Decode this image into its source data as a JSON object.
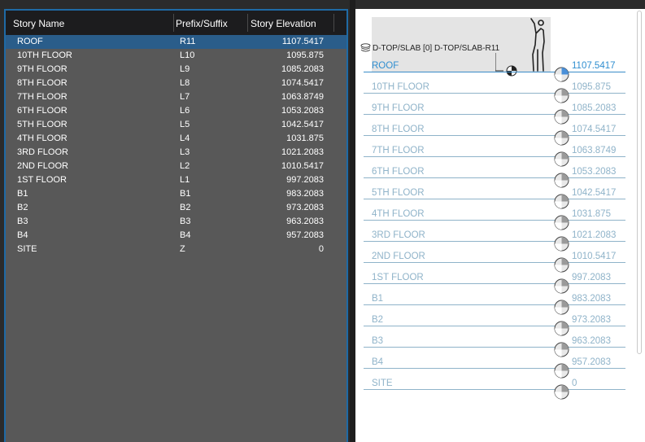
{
  "table": {
    "headers": {
      "name": "Story Name",
      "prefix": "Prefix/Suffix",
      "elevation": "Story Elevation"
    },
    "selected_index": 0,
    "rows": [
      {
        "name": "ROOF",
        "prefix": "R11",
        "elevation": "1107.5417"
      },
      {
        "name": "10TH FLOOR",
        "prefix": "L10",
        "elevation": "1095.875"
      },
      {
        "name": "9TH FLOOR",
        "prefix": "L9",
        "elevation": "1085.2083"
      },
      {
        "name": "8TH FLOOR",
        "prefix": "L8",
        "elevation": "1074.5417"
      },
      {
        "name": "7TH FLOOR",
        "prefix": "L7",
        "elevation": "1063.8749"
      },
      {
        "name": "6TH FLOOR",
        "prefix": "L6",
        "elevation": "1053.2083"
      },
      {
        "name": "5TH FLOOR",
        "prefix": "L5",
        "elevation": "1042.5417"
      },
      {
        "name": "4TH FLOOR",
        "prefix": "L4",
        "elevation": "1031.875"
      },
      {
        "name": "3RD FLOOR",
        "prefix": "L3",
        "elevation": "1021.2083"
      },
      {
        "name": "2ND FLOOR",
        "prefix": "L2",
        "elevation": "1010.5417"
      },
      {
        "name": "1ST FLOOR",
        "prefix": "L1",
        "elevation": "997.2083"
      },
      {
        "name": "B1",
        "prefix": "B1",
        "elevation": "983.2083"
      },
      {
        "name": "B2",
        "prefix": "B2",
        "elevation": "973.2083"
      },
      {
        "name": "B3",
        "prefix": "B3",
        "elevation": "963.2083"
      },
      {
        "name": "B4",
        "prefix": "B4",
        "elevation": "957.2083"
      },
      {
        "name": "SITE",
        "prefix": "Z",
        "elevation": "0"
      }
    ]
  },
  "preview": {
    "layer_tag": "D-TOP/SLAB [0] D-TOP/SLAB-R11",
    "icons": {
      "layer": "layers-icon",
      "figure": "human-scale-figure-icon",
      "marker": "elevation-marker-icon"
    },
    "stories": [
      {
        "name": "ROOF",
        "elevation": "1107.5417"
      },
      {
        "name": "10TH FLOOR",
        "elevation": "1095.875"
      },
      {
        "name": "9TH FLOOR",
        "elevation": "1085.2083"
      },
      {
        "name": "8TH FLOOR",
        "elevation": "1074.5417"
      },
      {
        "name": "7TH FLOOR",
        "elevation": "1063.8749"
      },
      {
        "name": "6TH FLOOR",
        "elevation": "1053.2083"
      },
      {
        "name": "5TH FLOOR",
        "elevation": "1042.5417"
      },
      {
        "name": "4TH FLOOR",
        "elevation": "1031.875"
      },
      {
        "name": "3RD FLOOR",
        "elevation": "1021.2083"
      },
      {
        "name": "2ND FLOOR",
        "elevation": "1010.5417"
      },
      {
        "name": "1ST FLOOR",
        "elevation": "997.2083"
      },
      {
        "name": "B1",
        "elevation": "983.2083"
      },
      {
        "name": "B2",
        "elevation": "973.2083"
      },
      {
        "name": "B3",
        "elevation": "963.2083"
      },
      {
        "name": "B4",
        "elevation": "957.2083"
      },
      {
        "name": "SITE",
        "elevation": "0"
      }
    ]
  },
  "colors": {
    "selection": "#2a5d8a",
    "accent_border": "#1f6aa5",
    "active_story": "#2f8ed0",
    "inactive_story": "#8fb3c9"
  }
}
